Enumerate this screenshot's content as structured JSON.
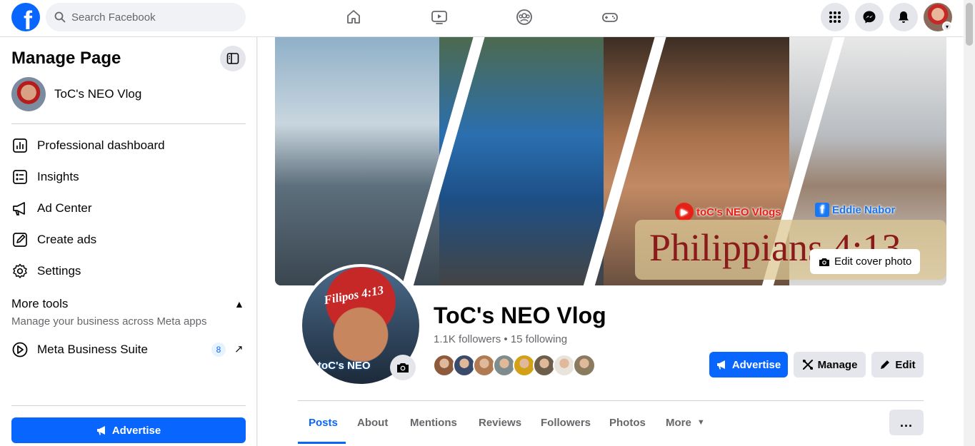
{
  "header": {
    "logo_letter": "f",
    "search_placeholder": "Search Facebook"
  },
  "sidebar": {
    "title": "Manage Page",
    "page_name": "ToC's NEO Vlog",
    "items": [
      {
        "label": "Professional dashboard",
        "icon": "dashboard-icon"
      },
      {
        "label": "Insights",
        "icon": "insights-icon"
      },
      {
        "label": "Ad Center",
        "icon": "megaphone-icon"
      },
      {
        "label": "Create ads",
        "icon": "pencil-square-icon"
      },
      {
        "label": "Settings",
        "icon": "gear-icon"
      }
    ],
    "more_tools": {
      "title": "More tools",
      "subtitle": "Manage your business across Meta apps"
    },
    "meta_suite": {
      "label": "Meta Business Suite",
      "badge": "8"
    },
    "advertise_label": "Advertise"
  },
  "cover": {
    "youtube_text": "toC's NEO Vlogs",
    "facebook_text": "Eddie Nabor",
    "verse_text": "Philippians 4:13",
    "edit_cover_label": "Edit cover photo"
  },
  "profile": {
    "pic_text": "Filipos 4:13",
    "pic_brand": "toC's NEO",
    "name": "ToC's NEO Vlog",
    "followers": "1.1K followers",
    "following": "15 following",
    "follower_avatar_colors": [
      "#8d5a3b",
      "#3a4a6b",
      "#b07a52",
      "#7f8c8d",
      "#d4a017",
      "#6d5d4b",
      "#e8e4dc",
      "#8a7a60"
    ]
  },
  "actions": {
    "advertise": "Advertise",
    "manage": "Manage",
    "edit": "Edit"
  },
  "tabs": {
    "items": [
      "Posts",
      "About",
      "Mentions",
      "Reviews",
      "Followers",
      "Photos",
      "More"
    ],
    "active": "Posts",
    "more_menu_label": "..."
  },
  "colors": {
    "brand_blue": "#0866ff",
    "secondary_gray": "#e4e6eb",
    "text_secondary": "#65676b"
  }
}
